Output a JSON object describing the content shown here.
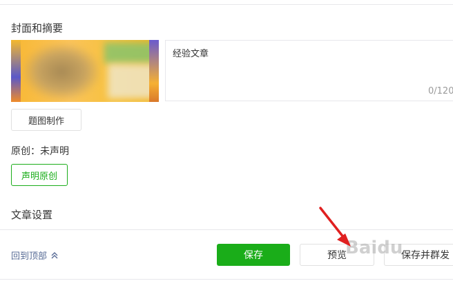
{
  "cover": {
    "title": "封面和摘要",
    "summary_text": "经验文章",
    "summary_count": "0/120",
    "make_cover_label": "题图制作"
  },
  "original": {
    "status": "原创：未声明",
    "declare_label": "声明原创"
  },
  "settings": {
    "title": "文章设置"
  },
  "footer": {
    "back_to_top": "回到顶部",
    "save_label": "保存",
    "preview_label": "预览",
    "publish_label": "保存并群发"
  },
  "watermark": "Baidu",
  "colors": {
    "primary_green": "#1aad19",
    "link_blue": "#576b95",
    "annotation_red": "#e02020"
  },
  "icons": [
    "chevron-double-up-icon",
    "red-arrow-annotation"
  ]
}
